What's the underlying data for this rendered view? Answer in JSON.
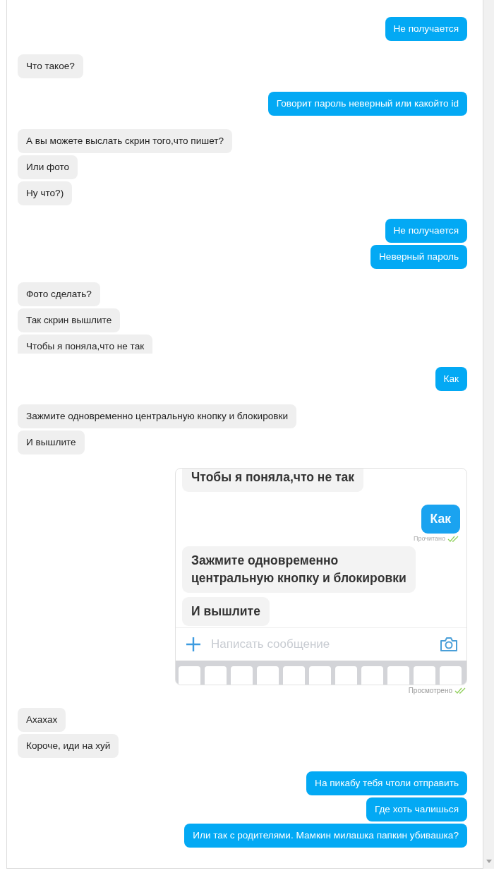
{
  "conversation": {
    "groups": [
      {
        "kind": "outgoing",
        "messages": [
          {
            "kind": "text",
            "text": "Не получается"
          }
        ]
      },
      {
        "kind": "incoming",
        "messages": [
          {
            "kind": "text",
            "text": "Что такое?"
          }
        ]
      },
      {
        "kind": "outgoing",
        "messages": [
          {
            "kind": "text",
            "text": "Говорит пароль неверный или какойто id"
          }
        ]
      },
      {
        "kind": "incoming",
        "messages": [
          {
            "kind": "text",
            "text": "А вы можете выслать скрин того,что пишет?"
          },
          {
            "kind": "text",
            "text": "Или фото"
          },
          {
            "kind": "text",
            "text": "Ну что?)"
          }
        ]
      },
      {
        "kind": "outgoing",
        "messages": [
          {
            "kind": "text",
            "text": "Не получается"
          },
          {
            "kind": "text",
            "text": "Неверный пароль"
          }
        ]
      },
      {
        "kind": "incoming",
        "messages": [
          {
            "kind": "text",
            "text": "Фото сделать?"
          },
          {
            "kind": "text",
            "text": "Так скрин вышлите"
          },
          {
            "kind": "clipped_text",
            "text": "Чтобы я поняла,что не так"
          }
        ]
      },
      {
        "kind": "outgoing",
        "messages": [
          {
            "kind": "text",
            "text": "Как"
          }
        ]
      },
      {
        "kind": "incoming",
        "messages": [
          {
            "kind": "text",
            "text": "Зажмите одновременно центральную кнопку и блокировки"
          },
          {
            "kind": "text",
            "text": "И вышлите"
          }
        ]
      },
      {
        "kind": "outgoing",
        "messages": [
          {
            "kind": "screenshot",
            "status": "Просмотрено",
            "screenshot": {
              "messages": [
                {
                  "kind": "incoming_clipped",
                  "text": "Чтобы я поняла,что не так"
                },
                {
                  "kind": "outgoing",
                  "text": "Как",
                  "status": "Прочитано"
                },
                {
                  "kind": "incoming",
                  "text": "Зажмите одновременно\nцентральную кнопку и блокировки"
                },
                {
                  "kind": "incoming",
                  "text": "И вышлите"
                }
              ],
              "composer": {
                "placeholder": "Написать сообщение"
              }
            }
          }
        ]
      },
      {
        "kind": "incoming",
        "messages": [
          {
            "kind": "text",
            "text": "Ахахах"
          },
          {
            "kind": "text",
            "text": "Короче, иди на хуй"
          }
        ]
      },
      {
        "kind": "outgoing",
        "messages": [
          {
            "kind": "text",
            "text": "На пикабу тебя чтоли отправить"
          },
          {
            "kind": "text",
            "text": "Где хоть чалишься"
          },
          {
            "kind": "text",
            "text": "Или так с родителями. Мамкин милашка папкин убивашка?"
          }
        ]
      }
    ]
  }
}
